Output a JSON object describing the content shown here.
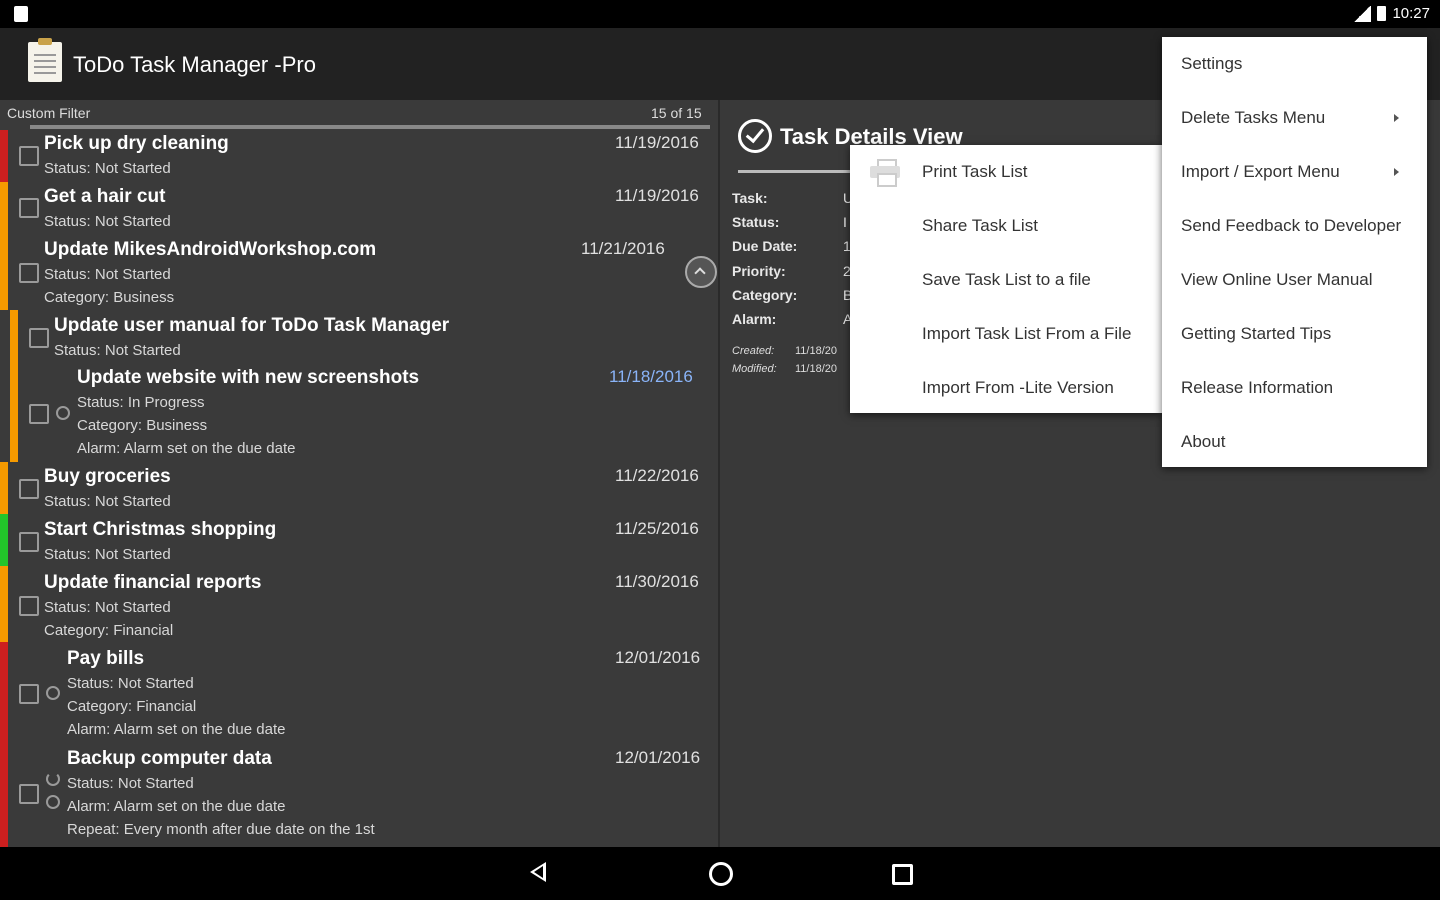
{
  "status_bar": {
    "time": "10:27"
  },
  "app_bar": {
    "title": "ToDo Task Manager -Pro"
  },
  "list": {
    "filter_label": "Custom Filter",
    "count_label": "15 of 15",
    "tasks": [
      {
        "title": "Pick up dry cleaning",
        "date": "11/19/2016",
        "lines": [
          "Status: Not Started"
        ]
      },
      {
        "title": "Get a hair cut",
        "date": "11/19/2016",
        "lines": [
          "Status: Not Started"
        ]
      },
      {
        "title": "Update MikesAndroidWorkshop.com",
        "date": "11/21/2016",
        "lines": [
          "Status: Not Started",
          "Category: Business"
        ]
      },
      {
        "title": "Update user manual for ToDo Task Manager",
        "date": "",
        "lines": [
          "Status: Not Started"
        ]
      },
      {
        "title": "Update website with new screenshots",
        "date": "11/18/2016",
        "lines": [
          "Status: In Progress",
          "Category: Business",
          "Alarm: Alarm set on the due date"
        ]
      },
      {
        "title": "Buy groceries",
        "date": "11/22/2016",
        "lines": [
          "Status: Not Started"
        ]
      },
      {
        "title": "Start Christmas shopping",
        "date": "11/25/2016",
        "lines": [
          "Status: Not Started"
        ]
      },
      {
        "title": "Update financial reports",
        "date": "11/30/2016",
        "lines": [
          "Status: Not Started",
          "Category: Financial"
        ]
      },
      {
        "title": "Pay bills",
        "date": "12/01/2016",
        "lines": [
          "Status: Not Started",
          "Category: Financial",
          "Alarm: Alarm set on the due date"
        ]
      },
      {
        "title": "Backup computer data",
        "date": "12/01/2016",
        "lines": [
          "Status: Not Started",
          "Alarm: Alarm set on the due date",
          "Repeat: Every month after due date on the 1st"
        ]
      }
    ]
  },
  "details": {
    "title": "Task Details View",
    "labels": {
      "task": "Task:",
      "status": "Status:",
      "due_date": "Due Date:",
      "priority": "Priority:",
      "category": "Category:",
      "alarm": "Alarm:",
      "created": "Created:",
      "modified": "Modified:"
    },
    "values": {
      "task": "U",
      "status": "I",
      "due_date": "1",
      "priority": "2",
      "category": "B",
      "alarm": "A",
      "created": "11/18/20",
      "modified": "11/18/20"
    }
  },
  "overflow_menu": {
    "items": [
      "Settings",
      "Delete Tasks Menu",
      "Import / Export Menu",
      "Send Feedback to Developer",
      "View Online User Manual",
      "Getting Started Tips",
      "Release Information",
      "About"
    ]
  },
  "submenu": {
    "items": [
      "Print Task List",
      "Share Task List",
      "Save Task List to a file",
      "Import Task List From a File",
      "Import From -Lite Version"
    ]
  },
  "colors": {
    "priority_red": "#cc1f1f",
    "priority_orange": "#f59a00",
    "priority_green": "#22c52a",
    "selected_date": "#8ab4f8",
    "background": "#333333",
    "menu_bg": "#ffffff"
  },
  "icons": [
    "sim-icon",
    "signal-icon",
    "battery-icon",
    "app-icon",
    "checkbox-icon",
    "alarm-icon",
    "repeat-icon",
    "check-circle-icon",
    "printer-icon",
    "chevron-right-icon",
    "back-icon",
    "home-icon",
    "recents-icon"
  ]
}
